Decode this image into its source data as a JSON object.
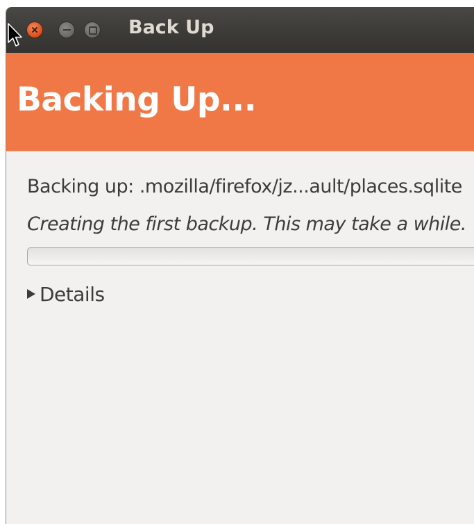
{
  "window": {
    "title": "Back Up",
    "controls": {
      "close": "close-icon",
      "minimize": "minimize-icon",
      "maximize": "maximize-icon"
    }
  },
  "banner": {
    "title": "Backing Up...",
    "color": "#f07846"
  },
  "status": {
    "text": "Backing up: .mozilla/firefox/jz...ault/places.sqlite",
    "message": "Creating the first backup.  This may take a while."
  },
  "progress": {
    "fraction": 0
  },
  "details": {
    "label": "Details",
    "expanded": false
  }
}
